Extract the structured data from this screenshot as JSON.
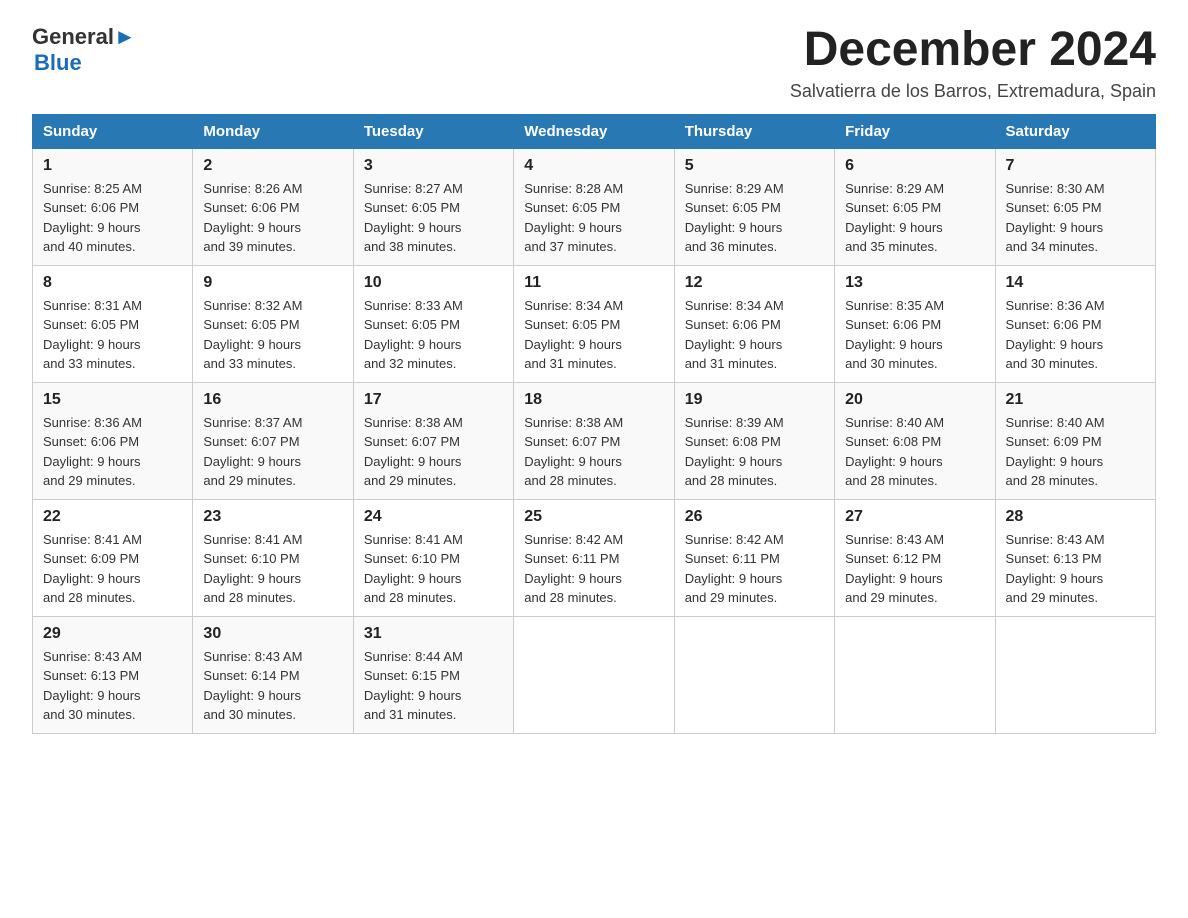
{
  "header": {
    "logo_general": "General",
    "logo_blue": "Blue",
    "month_title": "December 2024",
    "location": "Salvatierra de los Barros, Extremadura, Spain"
  },
  "days_of_week": [
    "Sunday",
    "Monday",
    "Tuesday",
    "Wednesday",
    "Thursday",
    "Friday",
    "Saturday"
  ],
  "weeks": [
    [
      {
        "day": "1",
        "sunrise": "Sunrise: 8:25 AM",
        "sunset": "Sunset: 6:06 PM",
        "daylight": "Daylight: 9 hours",
        "daylight2": "and 40 minutes."
      },
      {
        "day": "2",
        "sunrise": "Sunrise: 8:26 AM",
        "sunset": "Sunset: 6:06 PM",
        "daylight": "Daylight: 9 hours",
        "daylight2": "and 39 minutes."
      },
      {
        "day": "3",
        "sunrise": "Sunrise: 8:27 AM",
        "sunset": "Sunset: 6:05 PM",
        "daylight": "Daylight: 9 hours",
        "daylight2": "and 38 minutes."
      },
      {
        "day": "4",
        "sunrise": "Sunrise: 8:28 AM",
        "sunset": "Sunset: 6:05 PM",
        "daylight": "Daylight: 9 hours",
        "daylight2": "and 37 minutes."
      },
      {
        "day": "5",
        "sunrise": "Sunrise: 8:29 AM",
        "sunset": "Sunset: 6:05 PM",
        "daylight": "Daylight: 9 hours",
        "daylight2": "and 36 minutes."
      },
      {
        "day": "6",
        "sunrise": "Sunrise: 8:29 AM",
        "sunset": "Sunset: 6:05 PM",
        "daylight": "Daylight: 9 hours",
        "daylight2": "and 35 minutes."
      },
      {
        "day": "7",
        "sunrise": "Sunrise: 8:30 AM",
        "sunset": "Sunset: 6:05 PM",
        "daylight": "Daylight: 9 hours",
        "daylight2": "and 34 minutes."
      }
    ],
    [
      {
        "day": "8",
        "sunrise": "Sunrise: 8:31 AM",
        "sunset": "Sunset: 6:05 PM",
        "daylight": "Daylight: 9 hours",
        "daylight2": "and 33 minutes."
      },
      {
        "day": "9",
        "sunrise": "Sunrise: 8:32 AM",
        "sunset": "Sunset: 6:05 PM",
        "daylight": "Daylight: 9 hours",
        "daylight2": "and 33 minutes."
      },
      {
        "day": "10",
        "sunrise": "Sunrise: 8:33 AM",
        "sunset": "Sunset: 6:05 PM",
        "daylight": "Daylight: 9 hours",
        "daylight2": "and 32 minutes."
      },
      {
        "day": "11",
        "sunrise": "Sunrise: 8:34 AM",
        "sunset": "Sunset: 6:05 PM",
        "daylight": "Daylight: 9 hours",
        "daylight2": "and 31 minutes."
      },
      {
        "day": "12",
        "sunrise": "Sunrise: 8:34 AM",
        "sunset": "Sunset: 6:06 PM",
        "daylight": "Daylight: 9 hours",
        "daylight2": "and 31 minutes."
      },
      {
        "day": "13",
        "sunrise": "Sunrise: 8:35 AM",
        "sunset": "Sunset: 6:06 PM",
        "daylight": "Daylight: 9 hours",
        "daylight2": "and 30 minutes."
      },
      {
        "day": "14",
        "sunrise": "Sunrise: 8:36 AM",
        "sunset": "Sunset: 6:06 PM",
        "daylight": "Daylight: 9 hours",
        "daylight2": "and 30 minutes."
      }
    ],
    [
      {
        "day": "15",
        "sunrise": "Sunrise: 8:36 AM",
        "sunset": "Sunset: 6:06 PM",
        "daylight": "Daylight: 9 hours",
        "daylight2": "and 29 minutes."
      },
      {
        "day": "16",
        "sunrise": "Sunrise: 8:37 AM",
        "sunset": "Sunset: 6:07 PM",
        "daylight": "Daylight: 9 hours",
        "daylight2": "and 29 minutes."
      },
      {
        "day": "17",
        "sunrise": "Sunrise: 8:38 AM",
        "sunset": "Sunset: 6:07 PM",
        "daylight": "Daylight: 9 hours",
        "daylight2": "and 29 minutes."
      },
      {
        "day": "18",
        "sunrise": "Sunrise: 8:38 AM",
        "sunset": "Sunset: 6:07 PM",
        "daylight": "Daylight: 9 hours",
        "daylight2": "and 28 minutes."
      },
      {
        "day": "19",
        "sunrise": "Sunrise: 8:39 AM",
        "sunset": "Sunset: 6:08 PM",
        "daylight": "Daylight: 9 hours",
        "daylight2": "and 28 minutes."
      },
      {
        "day": "20",
        "sunrise": "Sunrise: 8:40 AM",
        "sunset": "Sunset: 6:08 PM",
        "daylight": "Daylight: 9 hours",
        "daylight2": "and 28 minutes."
      },
      {
        "day": "21",
        "sunrise": "Sunrise: 8:40 AM",
        "sunset": "Sunset: 6:09 PM",
        "daylight": "Daylight: 9 hours",
        "daylight2": "and 28 minutes."
      }
    ],
    [
      {
        "day": "22",
        "sunrise": "Sunrise: 8:41 AM",
        "sunset": "Sunset: 6:09 PM",
        "daylight": "Daylight: 9 hours",
        "daylight2": "and 28 minutes."
      },
      {
        "day": "23",
        "sunrise": "Sunrise: 8:41 AM",
        "sunset": "Sunset: 6:10 PM",
        "daylight": "Daylight: 9 hours",
        "daylight2": "and 28 minutes."
      },
      {
        "day": "24",
        "sunrise": "Sunrise: 8:41 AM",
        "sunset": "Sunset: 6:10 PM",
        "daylight": "Daylight: 9 hours",
        "daylight2": "and 28 minutes."
      },
      {
        "day": "25",
        "sunrise": "Sunrise: 8:42 AM",
        "sunset": "Sunset: 6:11 PM",
        "daylight": "Daylight: 9 hours",
        "daylight2": "and 28 minutes."
      },
      {
        "day": "26",
        "sunrise": "Sunrise: 8:42 AM",
        "sunset": "Sunset: 6:11 PM",
        "daylight": "Daylight: 9 hours",
        "daylight2": "and 29 minutes."
      },
      {
        "day": "27",
        "sunrise": "Sunrise: 8:43 AM",
        "sunset": "Sunset: 6:12 PM",
        "daylight": "Daylight: 9 hours",
        "daylight2": "and 29 minutes."
      },
      {
        "day": "28",
        "sunrise": "Sunrise: 8:43 AM",
        "sunset": "Sunset: 6:13 PM",
        "daylight": "Daylight: 9 hours",
        "daylight2": "and 29 minutes."
      }
    ],
    [
      {
        "day": "29",
        "sunrise": "Sunrise: 8:43 AM",
        "sunset": "Sunset: 6:13 PM",
        "daylight": "Daylight: 9 hours",
        "daylight2": "and 30 minutes."
      },
      {
        "day": "30",
        "sunrise": "Sunrise: 8:43 AM",
        "sunset": "Sunset: 6:14 PM",
        "daylight": "Daylight: 9 hours",
        "daylight2": "and 30 minutes."
      },
      {
        "day": "31",
        "sunrise": "Sunrise: 8:44 AM",
        "sunset": "Sunset: 6:15 PM",
        "daylight": "Daylight: 9 hours",
        "daylight2": "and 31 minutes."
      },
      null,
      null,
      null,
      null
    ]
  ]
}
